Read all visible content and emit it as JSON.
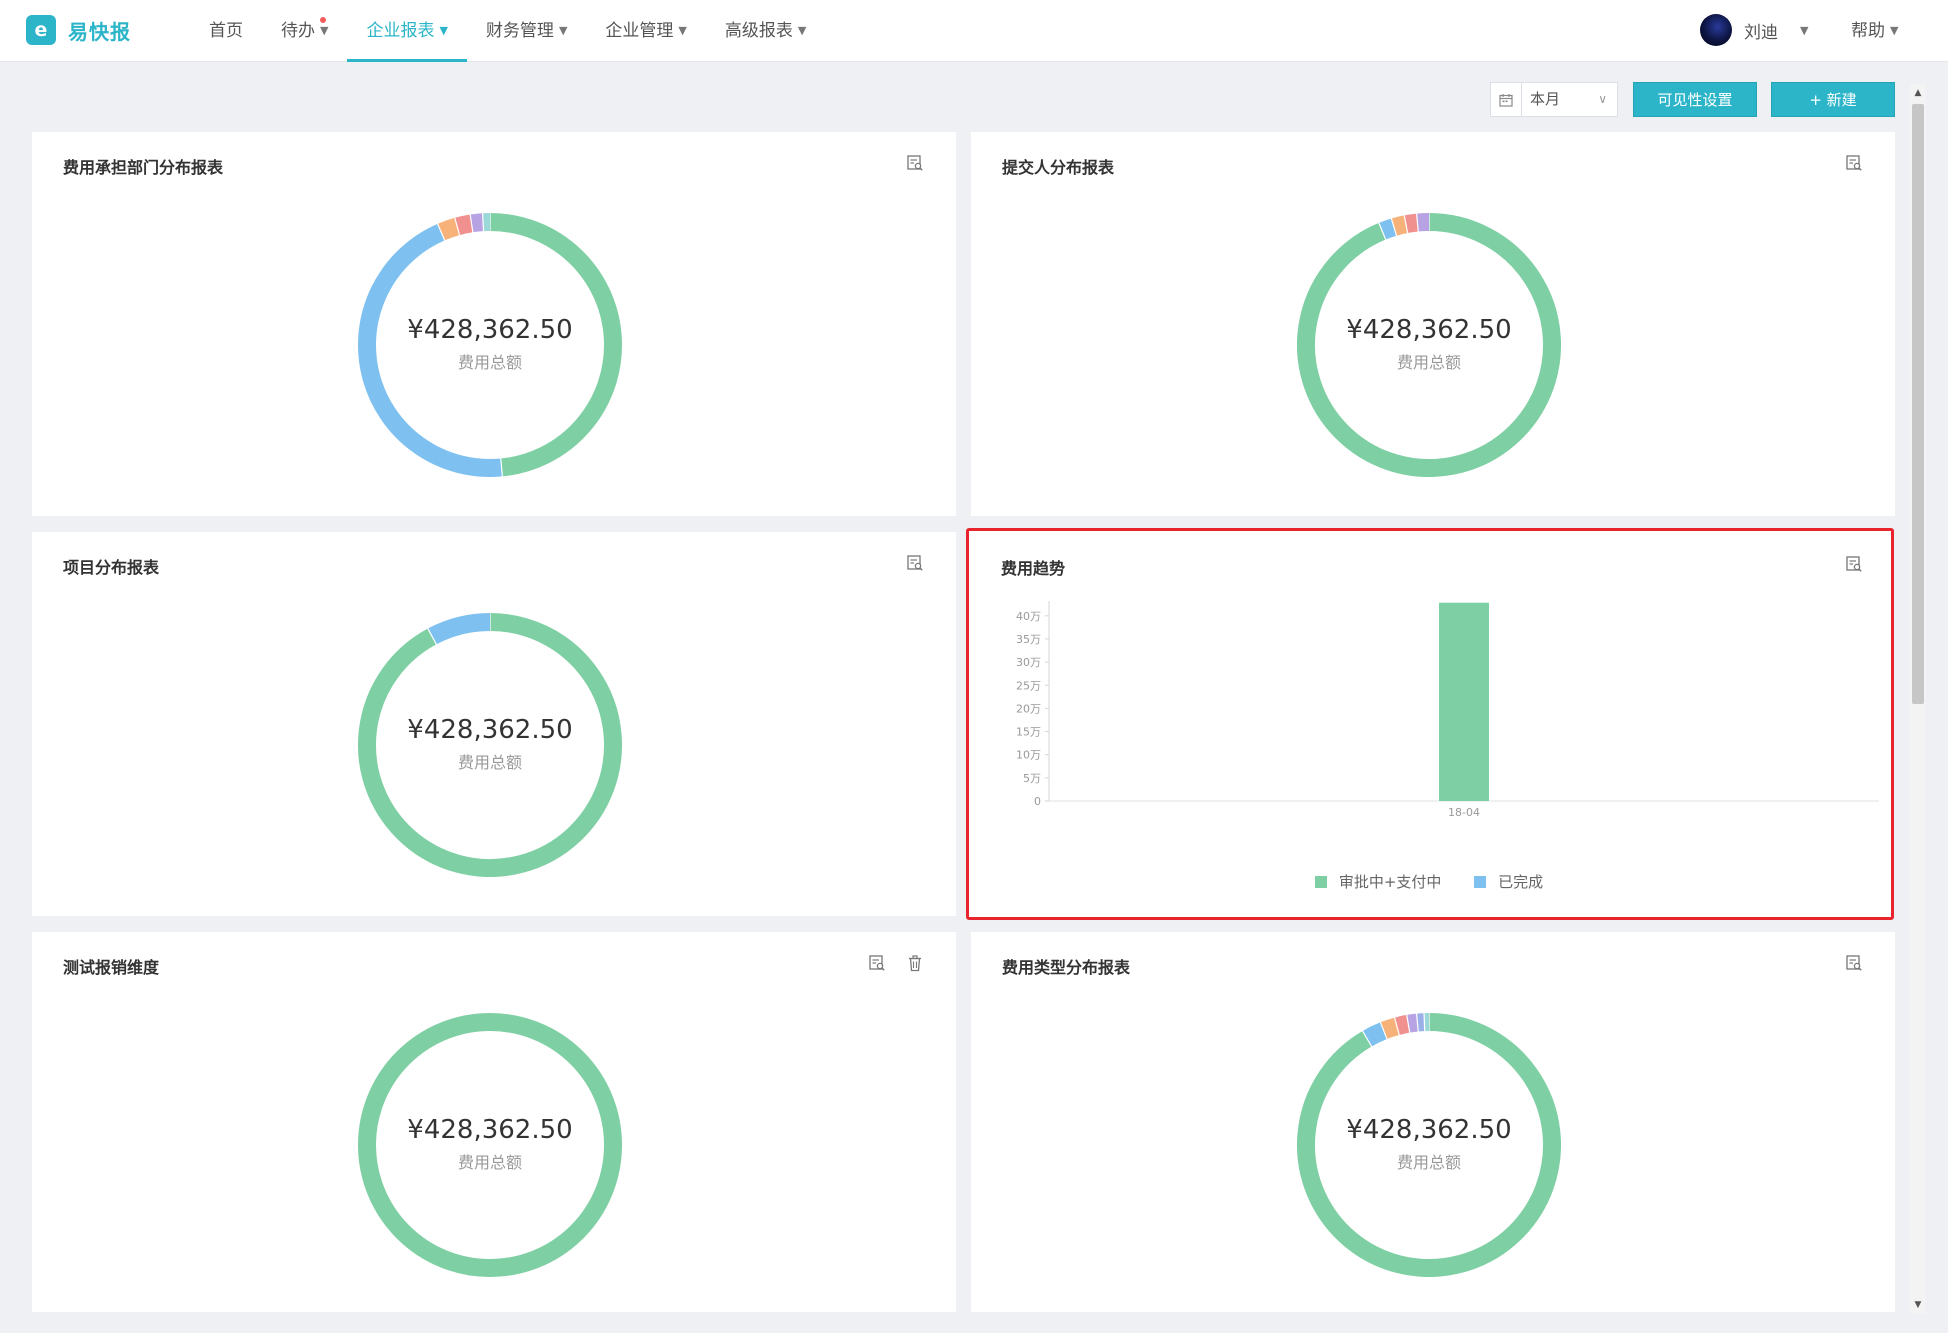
{
  "app": {
    "logo_glyph": "e",
    "name": "易快报",
    "nav": [
      {
        "label": "首页",
        "caret": false,
        "active": false,
        "dot": false
      },
      {
        "label": "待办",
        "caret": true,
        "active": false,
        "dot": true
      },
      {
        "label": "企业报表",
        "caret": true,
        "active": true,
        "dot": false
      },
      {
        "label": "财务管理",
        "caret": true,
        "active": false,
        "dot": false
      },
      {
        "label": "企业管理",
        "caret": true,
        "active": false,
        "dot": false
      },
      {
        "label": "高级报表",
        "caret": true,
        "active": false,
        "dot": false
      }
    ],
    "user_name": "刘迪",
    "help": "帮助",
    "accent_color": "#2cb5c9"
  },
  "toolbar": {
    "period": "本月",
    "visibility_button": "可见性设置",
    "new_button": "新建"
  },
  "icons": {
    "caret": "▼",
    "chevron": "∨",
    "plus": "+",
    "preview": "report-preview-icon",
    "delete": "trash-icon",
    "calendar": "calendar-icon",
    "scroll_down": "▼",
    "scroll_up": "▲"
  },
  "cards": [
    {
      "title": "费用承担部门分布报表",
      "amount": "¥428,362.50",
      "amount_label": "费用总额",
      "has_delete": false,
      "segments": [
        {
          "value": 48.5,
          "color": "#7ecfa3"
        },
        {
          "value": 45.0,
          "color": "#7ec1f0"
        },
        {
          "value": 2.2,
          "color": "#f7b27a"
        },
        {
          "value": 1.9,
          "color": "#f0918f"
        },
        {
          "value": 1.5,
          "color": "#b7a3e3"
        },
        {
          "value": 0.9,
          "color": "#9bd8d8"
        }
      ]
    },
    {
      "title": "提交人分布报表",
      "amount": "¥428,362.50",
      "amount_label": "费用总额",
      "has_delete": false,
      "segments": [
        {
          "value": 93.8,
          "color": "#7ecfa3"
        },
        {
          "value": 1.6,
          "color": "#7ec1f0"
        },
        {
          "value": 1.6,
          "color": "#f7b27a"
        },
        {
          "value": 1.5,
          "color": "#f0918f"
        },
        {
          "value": 1.5,
          "color": "#b7a3e3"
        }
      ]
    },
    {
      "title": "项目分布报表",
      "amount": "¥428,362.50",
      "amount_label": "费用总额",
      "has_delete": false,
      "segments": [
        {
          "value": 92.2,
          "color": "#7ecfa3"
        },
        {
          "value": 7.8,
          "color": "#7ec1f0"
        }
      ]
    },
    {
      "title": "测试报销维度",
      "amount": "¥428,362.50",
      "amount_label": "费用总额",
      "has_delete": true,
      "segments": [
        {
          "value": 100,
          "color": "#7ecfa3"
        }
      ]
    },
    {
      "title": "费用类型分布报表",
      "amount": "¥428,362.50",
      "amount_label": "费用总额",
      "has_delete": false,
      "segments": [
        {
          "value": 91.6,
          "color": "#7ecfa3"
        },
        {
          "value": 2.4,
          "color": "#7ec1f0"
        },
        {
          "value": 1.8,
          "color": "#f7b27a"
        },
        {
          "value": 1.5,
          "color": "#f0918f"
        },
        {
          "value": 1.2,
          "color": "#b7a3e3"
        },
        {
          "value": 0.9,
          "color": "#9bb0e8"
        },
        {
          "value": 0.6,
          "color": "#9bd8d8"
        }
      ]
    }
  ],
  "trend_card": {
    "title": "费用趋势",
    "legend": [
      "审批中+支付中",
      "已完成"
    ]
  },
  "chart_data": {
    "type": "bar",
    "categories": [
      "18-04"
    ],
    "series": [
      {
        "name": "审批中+支付中",
        "values": [
          428362.5
        ],
        "color": "#7ecfa3"
      },
      {
        "name": "已完成",
        "values": [
          0
        ],
        "color": "#7ec1f0"
      }
    ],
    "ytick_labels": [
      "0",
      "5万",
      "10万",
      "15万",
      "20万",
      "25万",
      "30万",
      "35万",
      "40万"
    ],
    "ylim": [
      0,
      400000
    ],
    "y_step": 50000,
    "legend_position": "bottom",
    "grid": false
  }
}
